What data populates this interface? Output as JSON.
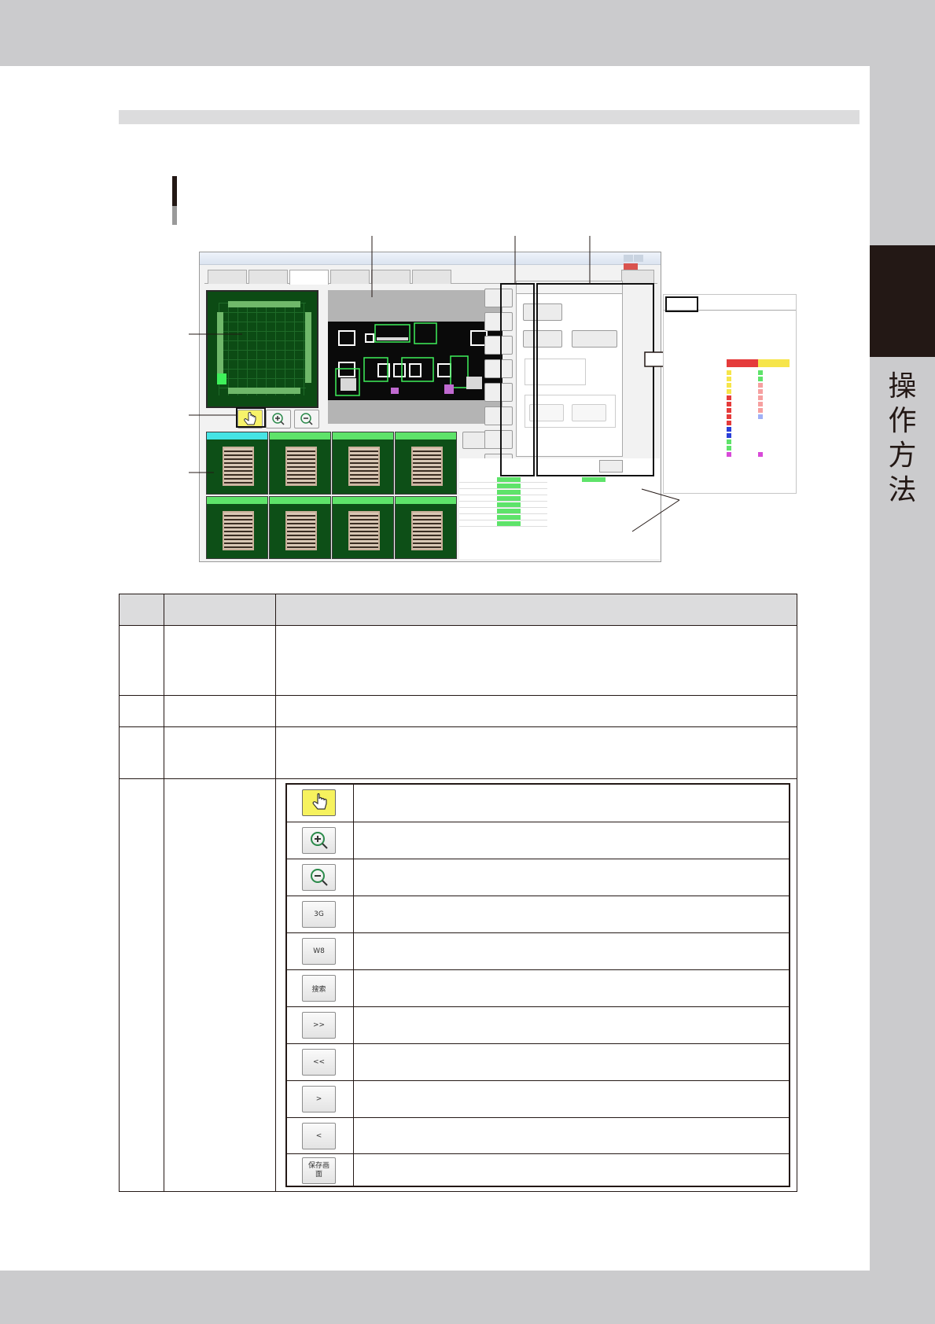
{
  "chapter": {
    "tab_label": [
      "操",
      "作",
      "方",
      "法"
    ]
  },
  "button_table": {
    "buttons": [
      {
        "icon": "hand-pointer-icon",
        "label": ""
      },
      {
        "icon": "zoom-in-icon",
        "label": ""
      },
      {
        "icon": "zoom-out-icon",
        "label": ""
      },
      {
        "icon": "text-button",
        "label": "3G"
      },
      {
        "icon": "text-button",
        "label": "W8"
      },
      {
        "icon": "text-button",
        "label": "搜索"
      },
      {
        "icon": "text-button",
        "label": ">>"
      },
      {
        "icon": "text-button",
        "label": "<<"
      },
      {
        "icon": "text-button",
        "label": ">"
      },
      {
        "icon": "text-button",
        "label": "<"
      },
      {
        "icon": "text-button",
        "label": "保存画面"
      }
    ]
  }
}
